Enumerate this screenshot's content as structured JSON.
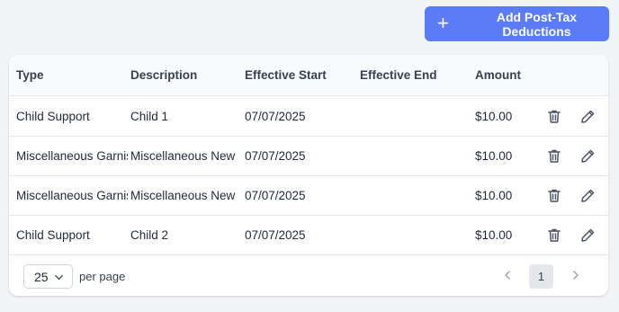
{
  "toolbar": {
    "add_label": "Add Post-Tax Deductions",
    "add_icon": "plus-icon"
  },
  "table": {
    "columns": [
      "Type",
      "Description",
      "Effective Start",
      "Effective End",
      "Amount"
    ],
    "rows": [
      {
        "type": "Child Support",
        "description": "Child 1",
        "start": "07/07/2025",
        "end": "",
        "amount": "$10.00"
      },
      {
        "type": "Miscellaneous Garnishment",
        "description": "Miscellaneous New Garnishment",
        "start": "07/07/2025",
        "end": "",
        "amount": "$10.00"
      },
      {
        "type": "Miscellaneous Garnishment",
        "description": "Miscellaneous New Garnishment",
        "start": "07/07/2025",
        "end": "",
        "amount": "$10.00"
      },
      {
        "type": "Child Support",
        "description": "Child 2",
        "start": "07/07/2025",
        "end": "",
        "amount": "$10.00"
      }
    ],
    "row_actions": [
      "trash-icon",
      "pencil-icon"
    ]
  },
  "pagination": {
    "per_page_value": "25",
    "per_page_label": "per page",
    "current_page": "1"
  },
  "colors": {
    "accent": "#5b7cf6",
    "header_bg": "#f9fafb",
    "border": "#e5e7eb"
  }
}
